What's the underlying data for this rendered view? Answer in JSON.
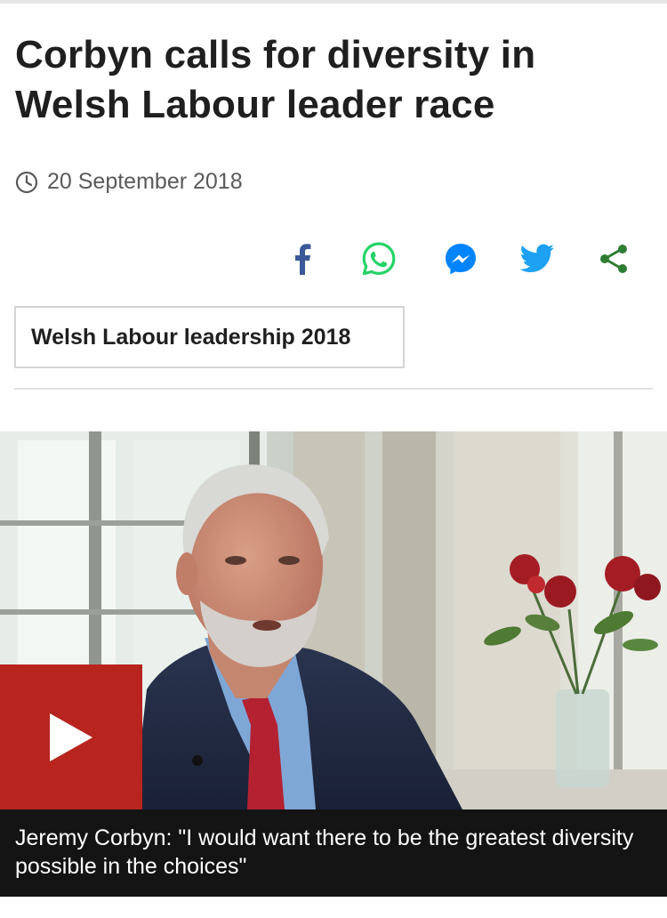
{
  "article": {
    "headline": "Corbyn calls for diversity in Welsh Labour leader race",
    "date": "20 September 2018",
    "topic_tag": "Welsh Labour leadership 2018"
  },
  "share": {
    "buttons": [
      {
        "name": "facebook",
        "icon": "facebook-icon",
        "color": "#3b5998"
      },
      {
        "name": "whatsapp",
        "icon": "whatsapp-icon",
        "color": "#25d366"
      },
      {
        "name": "messenger",
        "icon": "messenger-icon",
        "color": "#0084ff"
      },
      {
        "name": "twitter",
        "icon": "twitter-icon",
        "color": "#1da1f2"
      },
      {
        "name": "share",
        "icon": "share-icon",
        "color": "#2e7d32"
      }
    ]
  },
  "media": {
    "caption": "Jeremy Corbyn: \"I would want there to be the greatest diversity possible in the choices\"",
    "play_icon": "play-icon",
    "play_color": "#b7251e"
  }
}
